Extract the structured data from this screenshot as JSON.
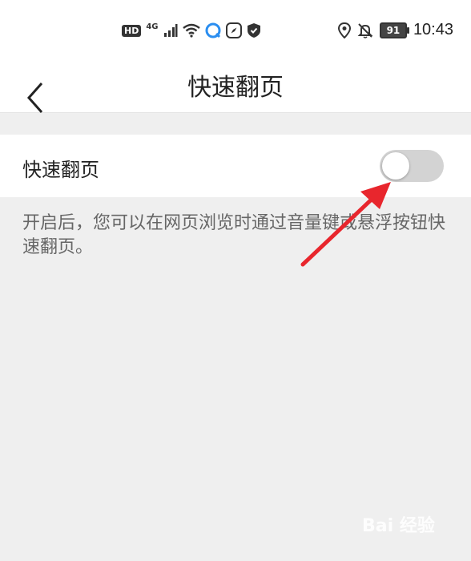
{
  "status_bar": {
    "hd_label": "HD",
    "network_label": "4G",
    "battery_level": "91",
    "time": "10:43"
  },
  "header": {
    "title": "快速翻页"
  },
  "settings": {
    "quick_page_turn": {
      "label": "快速翻页",
      "enabled": false
    },
    "description": "开启后，您可以在网页浏览时通过音量键或悬浮按钮快速翻页。"
  },
  "colors": {
    "annotation_arrow": "#e8262d",
    "toggle_off": "#d3d3d3",
    "background": "#efefef"
  },
  "watermark": {
    "text": "Bai 经验"
  }
}
